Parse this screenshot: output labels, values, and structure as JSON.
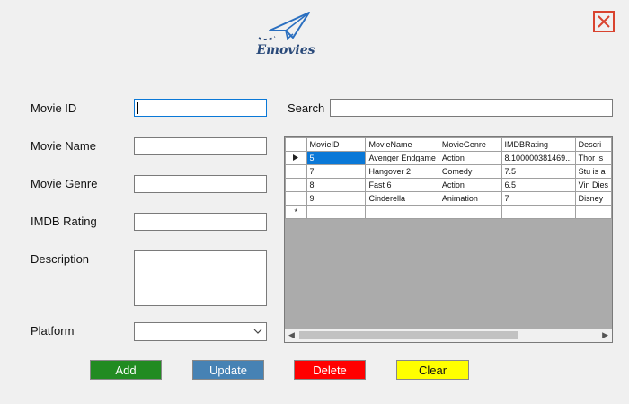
{
  "app": {
    "logo_text": "Emovies"
  },
  "form": {
    "movie_id_label": "Movie ID",
    "movie_name_label": "Movie Name",
    "movie_genre_label": "Movie Genre",
    "imdb_rating_label": "IMDB Rating",
    "description_label": "Description",
    "platform_label": "Platform",
    "movie_id_value": "",
    "movie_name_value": "",
    "movie_genre_value": "",
    "imdb_rating_value": "",
    "description_value": "",
    "platform_value": ""
  },
  "search": {
    "label": "Search",
    "value": ""
  },
  "grid": {
    "columns": [
      "MovieID",
      "MovieName",
      "MovieGenre",
      "IMDBRating",
      "Descri"
    ],
    "rows": [
      [
        "5",
        "Avenger Endgame",
        "Action",
        "8.100000381469...",
        "Thor is"
      ],
      [
        "7",
        "Hangover 2",
        "Comedy",
        "7.5",
        "Stu is a"
      ],
      [
        "8",
        "Fast 6",
        "Action",
        "6.5",
        "Vin Dies"
      ],
      [
        "9",
        "Cinderella",
        "Animation",
        "7",
        "Disney"
      ]
    ],
    "new_row_marker": "*"
  },
  "buttons": {
    "add": "Add",
    "update": "Update",
    "delete": "Delete",
    "clear": "Clear"
  },
  "colors": {
    "add": "#228b22",
    "update": "#4682b4",
    "delete": "#ff0000",
    "clear": "#ffff00",
    "close": "#d9432f",
    "selection": "#0a78d7"
  },
  "icons": {
    "logo": "paper-plane-icon",
    "close": "close-icon",
    "dropdown": "chevron-down-icon",
    "row_pointer": "row-pointer-icon"
  }
}
